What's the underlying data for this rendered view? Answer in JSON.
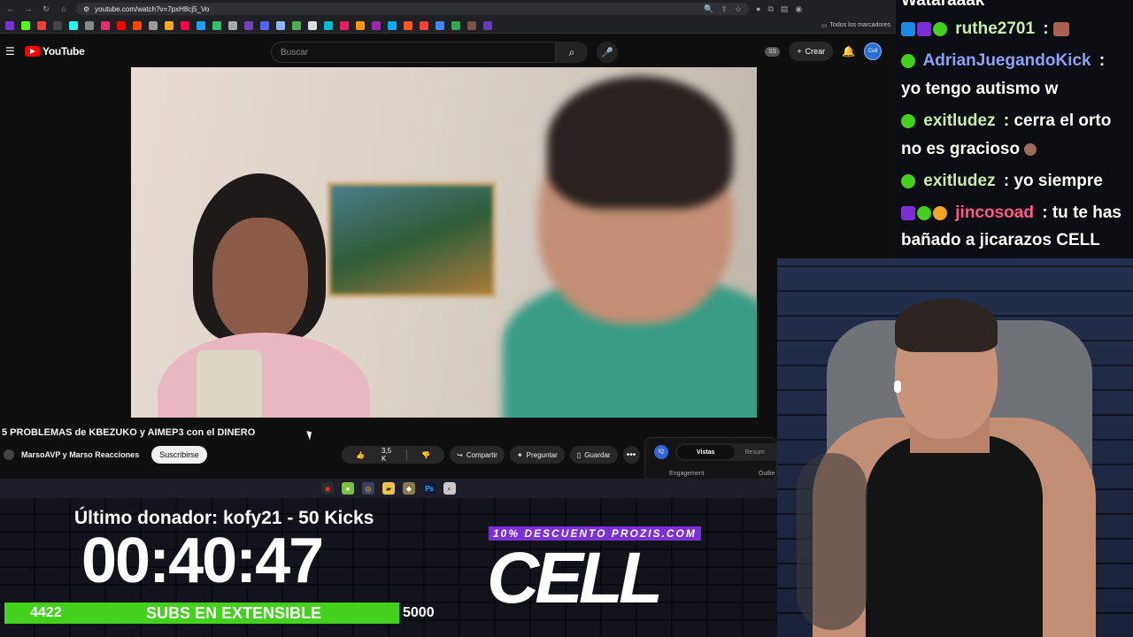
{
  "browser": {
    "url": "youtube.com/watch?v=7pxH8cj5_Vo",
    "bookmarks_folder": "Todos los marcadores"
  },
  "youtube": {
    "logo_text": "YouTube",
    "search_placeholder": "Buscar",
    "ss_badge": "SS",
    "create_label": "Crear",
    "avatar_text": "Cell"
  },
  "video": {
    "title": "5 PROBLEMAS de KBEZUKO y AIMEP3 con el DINERO",
    "channel": "MarsoAVP y Marso Reacciones",
    "subscribe_label": "Suscribirse",
    "likes": "3,5 K",
    "share_label": "Compartir",
    "ask_label": "Preguntar",
    "save_label": "Guardar"
  },
  "side_panel": {
    "logo_text": "IQ",
    "tab_active": "Vistas",
    "tab_other": "Resum",
    "row_left": "Engagement",
    "row_right": "Outlie"
  },
  "overlay": {
    "donor_text": "Último donador: kofy21 - 50 Kicks",
    "timer": "00:40:47",
    "subs_current": "4422",
    "subs_label": "SUBS EN EXTENSIBLE",
    "subs_goal": "5000",
    "subs_progress": 0.8844,
    "promo": "10% DESCUENTO PROZIS.COM",
    "logo": "CELL"
  },
  "chat": {
    "messages": [
      {
        "user": "Wataraaak",
        "text": "",
        "color": "#ffffff"
      },
      {
        "user": "ruthe2701",
        "text": ":",
        "color": "#c9f0a8"
      },
      {
        "user": "AdrianJuegandoKick",
        "text": ":",
        "color": "#8aa3ff"
      },
      {
        "user": "",
        "text": "yo tengo autismo w",
        "color": "#ffffff"
      },
      {
        "user": "exitludez",
        "text": ": cerra el orto",
        "color": "#c9f0a8"
      },
      {
        "user": "",
        "text": "no es gracioso",
        "color": "#ffffff"
      },
      {
        "user": "exitludez",
        "text": ": yo siempre",
        "color": "#c9f0a8"
      },
      {
        "user": "jincosoad",
        "text": ": tu te has",
        "color": "#ff5a8a"
      },
      {
        "user": "",
        "text": "bañado a jicarazos CELL",
        "color": "#ffffff"
      }
    ]
  },
  "colors": {
    "subs_bar": "#43d11e",
    "promo_bg": "#7b2fd6",
    "yt_red": "#ff0000"
  }
}
